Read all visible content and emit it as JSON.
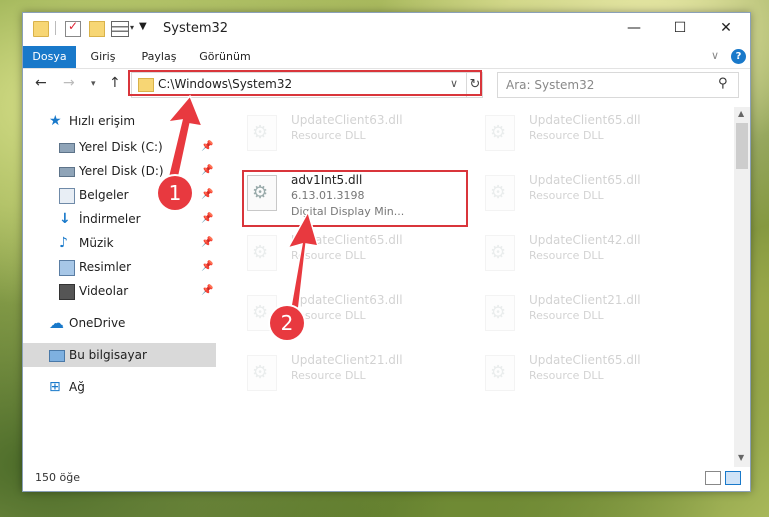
{
  "window": {
    "title": "System32",
    "controls": {
      "minimize": "—",
      "maximize": "☐",
      "close": "✕"
    }
  },
  "ribbon": {
    "tabs": [
      "Dosya",
      "Giriş",
      "Paylaş",
      "Görünüm"
    ],
    "help": "?"
  },
  "address": {
    "path": "C:\\Windows\\System32"
  },
  "search": {
    "placeholder": "Ara: System32"
  },
  "sidebar": {
    "items": [
      {
        "label": "Hızlı erişim",
        "icon": "star-icon",
        "pinned": false
      },
      {
        "label": "Yerel Disk (C:)",
        "icon": "drive-icon",
        "pinned": true
      },
      {
        "label": "Yerel Disk (D:)",
        "icon": "drive-icon",
        "pinned": true
      },
      {
        "label": "Belgeler",
        "icon": "documents-icon",
        "pinned": true
      },
      {
        "label": "İndirmeler",
        "icon": "download-icon",
        "pinned": true
      },
      {
        "label": "Müzik",
        "icon": "music-icon",
        "pinned": true
      },
      {
        "label": "Resimler",
        "icon": "pictures-icon",
        "pinned": true
      },
      {
        "label": "Videolar",
        "icon": "video-icon",
        "pinned": true
      },
      {
        "label": "OneDrive",
        "icon": "cloud-icon",
        "pinned": false
      },
      {
        "label": "Bu bilgisayar",
        "icon": "computer-icon",
        "pinned": false,
        "selected": true
      },
      {
        "label": "Ağ",
        "icon": "network-icon",
        "pinned": false
      }
    ]
  },
  "files": {
    "active": {
      "name": "adv1Int5.dll",
      "version": "6.13.01.3198",
      "description": "Digital Display Min..."
    },
    "faded": [
      {
        "name": "UpdateClient63.dll",
        "type": "Resource DLL"
      },
      {
        "name": "UpdateClient65.dll",
        "type": "Resource DLL"
      },
      {
        "name": "UpdateClient65.dll",
        "type": "Resource DLL"
      },
      {
        "name": "UpdateClient65.dll",
        "type": "Resource DLL"
      },
      {
        "name": "UpdateClient42.dll",
        "type": "Resource DLL"
      },
      {
        "name": "UpdateClient63.dll",
        "type": "Resource DLL"
      },
      {
        "name": "UpdateClient21.dll",
        "type": "Resource DLL"
      },
      {
        "name": "UpdateClient21.dll",
        "type": "Resource DLL"
      },
      {
        "name": "UpdateClient65.dll",
        "type": "Resource DLL"
      }
    ]
  },
  "status": {
    "count": "150 öğe"
  },
  "annotations": {
    "step1": "1",
    "step2": "2",
    "color": "#e8393f"
  }
}
